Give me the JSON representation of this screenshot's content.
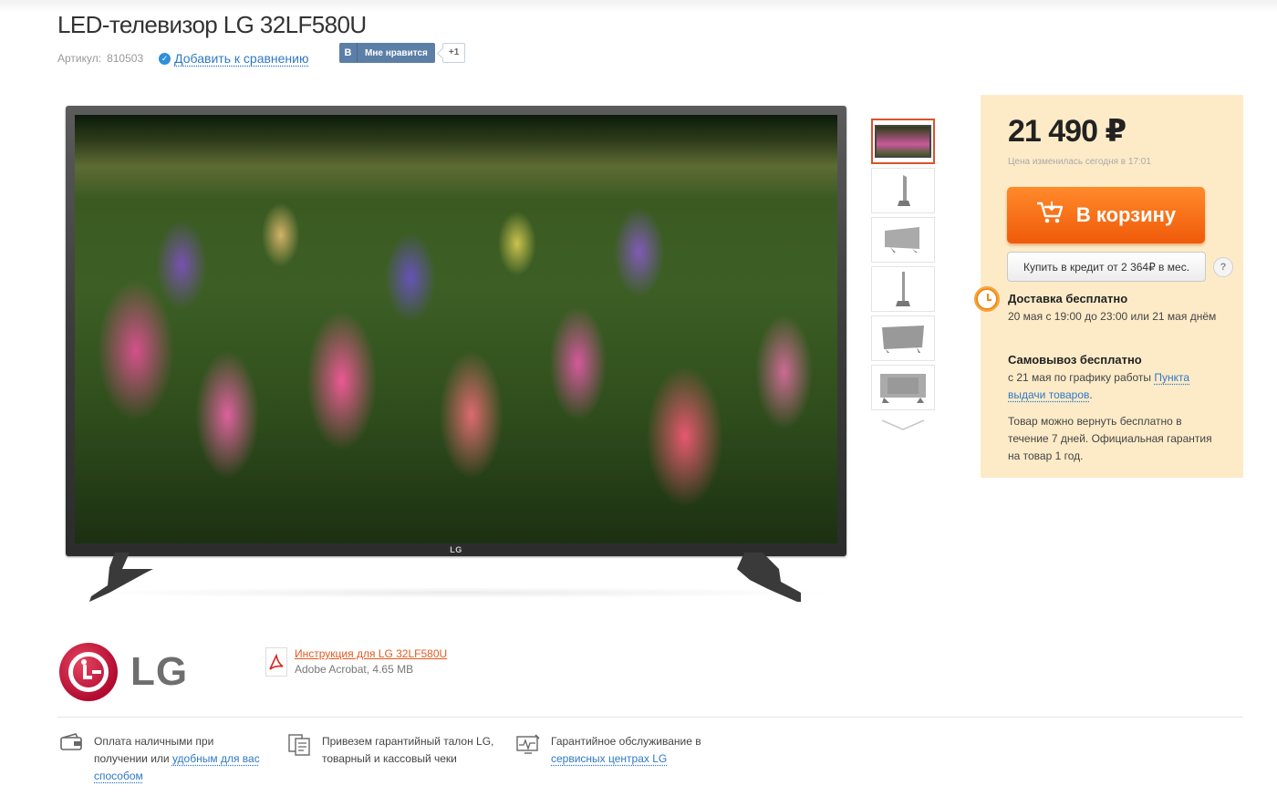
{
  "product": {
    "title": "LED-телевизор LG 32LF580U",
    "sku_label": "Артикул:",
    "sku_value": "810503",
    "compare_label": "Добавить к сравнению"
  },
  "social": {
    "vk_logo": "В",
    "vk_like_label": "Мне нравится",
    "vk_count": "+1"
  },
  "gallery": {
    "tv_brand_mark": "LG",
    "thumbnails": [
      "front-view",
      "side-view",
      "angle-view",
      "profile-view",
      "back-angle-view",
      "back-view"
    ],
    "scroll_down_icon": "chevron-down-icon"
  },
  "purchase": {
    "price": "21 490 ₽",
    "price_note": "Цена изменилась сегодня в 17:01",
    "cart_label": "В корзину",
    "credit_label": "Купить в кредит от 2 364₽ в мес.",
    "help_label": "?",
    "accent_color": "#f26b1d",
    "box_color": "#fdebc8"
  },
  "delivery": {
    "title": "Доставка бесплатно",
    "text": "20 мая с 19:00 до 23:00 или 21 мая днём"
  },
  "pickup": {
    "title": "Самовывоз бесплатно",
    "text_before": "с 21 мая по графику работы ",
    "link": "Пункта выдачи товаров",
    "text_after": "."
  },
  "returns": {
    "text": "Товар можно вернуть бесплатно в течение 7 дней. Официальная гарантия на товар 1 год."
  },
  "brand": {
    "name": "LG",
    "manual_link": "Инструкция для LG 32LF580U",
    "manual_meta": "Adobe Acrobat, 4.65 MB"
  },
  "features": [
    {
      "text_before": "Оплата наличными при получении или ",
      "link": "удобным для вас способом",
      "text_after": ""
    },
    {
      "text_before": "Привезем гарантийный талон LG, товарный и кассовый чеки",
      "link": "",
      "text_after": ""
    },
    {
      "text_before": "Гарантийное обслуживание в ",
      "link": "сервисных центрах LG",
      "text_after": ""
    }
  ]
}
